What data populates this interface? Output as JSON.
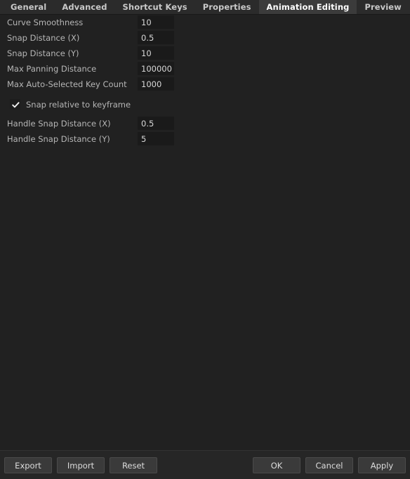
{
  "tabs": [
    {
      "label": "General",
      "active": false
    },
    {
      "label": "Advanced",
      "active": false
    },
    {
      "label": "Shortcut Keys",
      "active": false
    },
    {
      "label": "Properties",
      "active": false
    },
    {
      "label": "Animation Editing",
      "active": true
    },
    {
      "label": "Preview",
      "active": false
    }
  ],
  "settings": {
    "rows": [
      {
        "label": "Curve Smoothness",
        "value": "10"
      },
      {
        "label": "Snap Distance (X)",
        "value": "0.5"
      },
      {
        "label": "Snap Distance (Y)",
        "value": "10"
      },
      {
        "label": "Max Panning Distance",
        "value": "100000"
      },
      {
        "label": "Max Auto-Selected Key Count",
        "value": "1000"
      }
    ],
    "checkbox": {
      "label": "Snap relative to keyframe",
      "checked": true,
      "icon": "check-icon"
    },
    "rows2": [
      {
        "label": "Handle Snap Distance (X)",
        "value": "0.5"
      },
      {
        "label": "Handle Snap Distance (Y)",
        "value": "5"
      }
    ]
  },
  "footer": {
    "export_label": "Export",
    "import_label": "Import",
    "reset_label": "Reset",
    "ok_label": "OK",
    "cancel_label": "Cancel",
    "apply_label": "Apply"
  },
  "colors": {
    "background": "#212121",
    "tabbar": "#2b2b2b",
    "active_tab": "#3b3b3b",
    "field_bg": "#1a1a1a",
    "label_text": "#b6b6b6",
    "value_text": "#d8d8d8",
    "footer_bg": "#262626",
    "button_bg": "#3a3a3a"
  }
}
